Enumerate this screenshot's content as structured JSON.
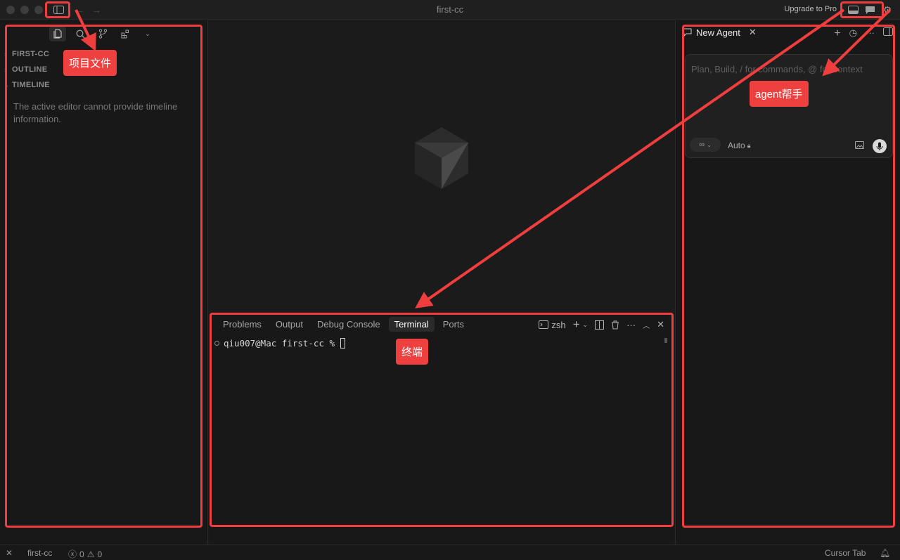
{
  "window": {
    "title": "first-cc",
    "upgrade_label": "Upgrade to Pro"
  },
  "sidebar": {
    "sections": [
      {
        "label": "FIRST-CC",
        "collapsed": true
      },
      {
        "label": "OUTLINE",
        "collapsed": true
      },
      {
        "label": "TIMELINE",
        "collapsed": false
      }
    ],
    "timeline_message": "The active editor cannot provide timeline information."
  },
  "panel": {
    "tabs": [
      "Problems",
      "Output",
      "Debug Console",
      "Terminal",
      "Ports"
    ],
    "active_tab": "Terminal",
    "shell_label": "zsh",
    "prompt": "qiu007@Mac first-cc %"
  },
  "agent": {
    "tab_label": "New Agent",
    "input_placeholder": "Plan, Build, / for commands, @ for context",
    "mode_label": "Auto"
  },
  "statusbar": {
    "workspace": "first-cc",
    "errors": "0",
    "warnings": "0",
    "right_label": "Cursor Tab"
  },
  "annotations": {
    "files_label": "项目文件",
    "agent_label": "agent帮手",
    "terminal_label": "终端",
    "color": "#f03e3e"
  }
}
